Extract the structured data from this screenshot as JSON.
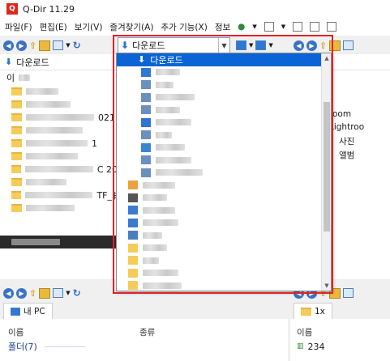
{
  "window": {
    "title": "Q-Dir 11.29",
    "logo_text": "Q"
  },
  "menu": [
    {
      "label": "파일(F)"
    },
    {
      "label": "편집(E)"
    },
    {
      "label": "보기(V)"
    },
    {
      "label": "즐겨찾기(A)"
    },
    {
      "label": "추가 기능(X)"
    },
    {
      "label": "정보"
    }
  ],
  "address_bar": {
    "label": "다운로드"
  },
  "left_pane": {
    "header": "다운로드",
    "col_first": "이",
    "visible_suffixes": [
      "021",
      "1",
      "C 20",
      "TF_$"
    ]
  },
  "dropdown": {
    "selected": "다운로드",
    "item_icons": [
      "download-icon",
      "monitor-icon",
      "generic-icon",
      "generic-icon",
      "generic-icon",
      "music-icon",
      "generic-icon",
      "image-icon",
      "generic-icon",
      "generic-icon",
      "home-folder-icon",
      "drive-icon",
      "network-icon",
      "control-panel-icon",
      "recycle-bin-icon",
      "folder-icon",
      "folder-icon",
      "folder-icon",
      "folder-icon"
    ]
  },
  "right_pane": {
    "visible_text": [
      "oom",
      "Lightroo",
      "사진",
      "앨범"
    ]
  },
  "bottom_left": {
    "tab": "내 PC",
    "col_name": "이름",
    "col_type": "종류",
    "row_label": "폴더(7)"
  },
  "bottom_right": {
    "tab": "1x",
    "col_name": "이름",
    "row_value": "234"
  }
}
